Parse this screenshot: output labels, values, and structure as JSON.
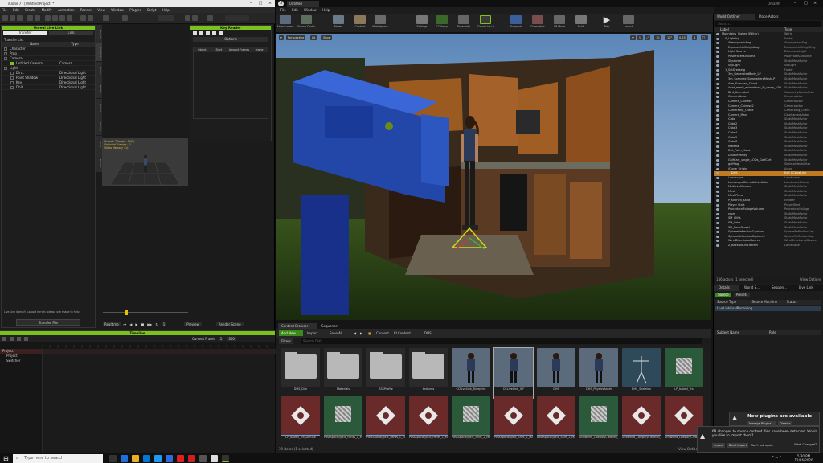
{
  "left_app": {
    "title": "iClone 7 - [Untitled Project] *",
    "menu": [
      "File",
      "Edit",
      "Create",
      "Modify",
      "Animation",
      "Render",
      "View",
      "Window",
      "Plugins",
      "Script",
      "Help"
    ],
    "transfer_title": "Unreal Live Link",
    "tabs": [
      "Transfer",
      "Link"
    ],
    "transfer_list_label": "Transfer List",
    "col_name": "Name",
    "col_type": "Type",
    "transfer_rows": [
      {
        "name": "Character",
        "type": ""
      },
      {
        "name": "Prop",
        "type": ""
      },
      {
        "name": "Camera",
        "type": ""
      },
      {
        "name": "Untitled Camera",
        "type": "Camera"
      },
      {
        "name": "Light",
        "type": ""
      },
      {
        "name": "Dirct",
        "type": "Directional Light"
      },
      {
        "name": "Point Shadow",
        "type": "Directional Light"
      },
      {
        "name": "Key",
        "type": "Directional Light"
      },
      {
        "name": "Dhit",
        "type": "Directional Light"
      }
    ],
    "side_tabs": [
      "Project",
      "Content",
      "Scene",
      "Modify",
      "Visual",
      "Library",
      "Anim",
      "Render"
    ],
    "hint": "Live Link doesn't support terrain, please use shape to help.",
    "transfer_button": "Transfer File",
    "keyreader": {
      "title": "Key Reader",
      "panel": "Options",
      "cols": [
        "Object",
        "Start",
        "Amount Frames",
        "Frame"
      ]
    },
    "viewport_overlay": [
      "Smooth Triangle : 10(2)",
      "Selected Triangle : 0",
      "Video Memory : 1/1"
    ],
    "playback": {
      "realtime": "Realtime",
      "frame": "1",
      "preview": "Preview",
      "render_scene": "Render Scene"
    },
    "timeline": {
      "title": "Timeline",
      "current_frame": "1",
      "end_frame": "300",
      "tracks": [
        "Project",
        "Project",
        "Switcher"
      ]
    }
  },
  "ue": {
    "tab": "Untitled",
    "window_label": "OmaMh",
    "menu": [
      "File",
      "Edit",
      "Window",
      "Help"
    ],
    "toolbar": [
      {
        "label": "Save Current",
        "icon": "save-icon"
      },
      {
        "label": "Source Control",
        "icon": "source-control-icon"
      },
      {
        "label": "Modes",
        "icon": "modes-icon"
      },
      {
        "label": "Content",
        "icon": "content-icon"
      },
      {
        "label": "Marketplace",
        "icon": "marketplace-icon"
      },
      {
        "label": "Settings",
        "icon": "settings-icon"
      },
      {
        "label": "CC Setup",
        "icon": "cc-setup-icon"
      },
      {
        "label": "Datasmith",
        "icon": "datasmith-icon"
      },
      {
        "label": "iClone Live Link",
        "icon": "iclone-live-link-icon"
      },
      {
        "label": "Blueprints",
        "icon": "blueprints-icon"
      },
      {
        "label": "Cinematics",
        "icon": "cinematics-icon"
      },
      {
        "label": "VR Mode",
        "icon": "vr-mode-icon"
      },
      {
        "label": "Build",
        "icon": "build-icon"
      },
      {
        "label": "Play",
        "icon": "play-icon"
      },
      {
        "label": "Launch",
        "icon": "launch-icon"
      }
    ],
    "viewport": {
      "perspective": "Perspective",
      "lit": "Lit",
      "show": "Show",
      "grid": "10",
      "angle": "10°",
      "scale": "0.25",
      "speed": "4"
    },
    "content_browser": {
      "tabs": [
        "Content Browser",
        "Sequencer"
      ],
      "add_new": "Add New",
      "import": "Import",
      "save_all": "Save All",
      "path": [
        "Content",
        "RLContent",
        "DHS"
      ],
      "filters": "Filters",
      "search_placeholder": "Search DHS",
      "status": "39 items (1 selected)",
      "view_options": "View Options",
      "assets_row1": [
        {
          "label": "DHS_Dim",
          "type": "folder"
        },
        {
          "label": "Materials",
          "type": "folder"
        },
        {
          "label": "SSSProfile",
          "type": "folder"
        },
        {
          "label": "textures",
          "type": "folder"
        },
        {
          "label": "CCLiveLink_Blueprint",
          "type": "char"
        },
        {
          "label": "CCLiveLink_ICF",
          "type": "char"
        },
        {
          "label": "DHS",
          "type": "char"
        },
        {
          "label": "DHS_PhysicsAsset",
          "type": "char"
        },
        {
          "label": "DHS_Skeleton",
          "type": "skeleton"
        },
        {
          "label": "LP_baked_Tra",
          "type": "texture"
        }
      ],
      "assets_row2": [
        {
          "label": "LP_baked_Tra_Diffuse",
          "type": "material"
        },
        {
          "label": "PostApocalyptic_Pants_1_MAT_Pbr",
          "type": "texture"
        },
        {
          "label": "PostApocalyptic_Pants_1_MAT_Pbr_Diffuse",
          "type": "material"
        },
        {
          "label": "PostApocalyptic_Pants_1_MAT_Pbr_Normal",
          "type": "material"
        },
        {
          "label": "PostApocalyptic_Shirt_2_MAT_Pbr",
          "type": "texture"
        },
        {
          "label": "PostApocalyptic_Shirt_2_MAT_Pbr_Diffuse",
          "type": "material"
        },
        {
          "label": "PostApocalyptic_Shirt_2_MAT_Pbr_Normal",
          "type": "material"
        },
        {
          "label": "Snowbird_LowpolyCleaned_baked_Tra",
          "type": "texture"
        },
        {
          "label": "Snowbird_LowpolyCleaned_baked_Tra_Diffuse",
          "type": "material"
        },
        {
          "label": "Snowbird_LowpolyCleaned_baked_Tra_Normal",
          "type": "material"
        }
      ]
    },
    "outliner": {
      "tabs": [
        "World Outliner",
        "Place Actors"
      ],
      "search_placeholder": "Search...",
      "col_label": "Label",
      "col_type": "Type",
      "rows": [
        {
          "name": "Mountains_Slaked (Editor)",
          "type": "World",
          "d": 0
        },
        {
          "name": "0_Lighting",
          "type": "Folder",
          "d": 1
        },
        {
          "name": "AtmosphericFog",
          "type": "AtmosphericFog",
          "d": 2
        },
        {
          "name": "ExponentialHeightFog",
          "type": "ExponentialHeightFog",
          "d": 2
        },
        {
          "name": "Light Source",
          "type": "DirectionalLight",
          "d": 2
        },
        {
          "name": "PostProcessVolume",
          "type": "PostProcessVolume",
          "d": 2
        },
        {
          "name": "Skydome",
          "type": "StaticMeshActor",
          "d": 2
        },
        {
          "name": "SkyLight",
          "type": "SkyLight",
          "d": 2
        },
        {
          "name": "1_SetDressing",
          "type": "Folder",
          "d": 1
        },
        {
          "name": "3m_GeneratedBody_LP",
          "type": "StaticMeshActor",
          "d": 2
        },
        {
          "name": "3m_Scanned_SomewhereMeshLP",
          "type": "StaticMeshActor",
          "d": 2
        },
        {
          "name": "Arm_Scanned_Coord",
          "type": "StaticMeshActor",
          "d": 2
        },
        {
          "name": "Aunt_mesh_animations_M_camp_LOD",
          "type": "StaticMeshActor",
          "d": 2
        },
        {
          "name": "Bird_Animated",
          "type": "GeometryCacheActor",
          "d": 2
        },
        {
          "name": "CameraActor",
          "type": "CameraActor",
          "d": 2
        },
        {
          "name": "Camera_Chinese",
          "type": "CameraActor",
          "d": 2
        },
        {
          "name": "Camera_Chinese2",
          "type": "CameraActor",
          "d": 2
        },
        {
          "name": "CameraRig_Crane",
          "type": "CameraRig_Crane",
          "d": 2
        },
        {
          "name": "Camera_Mara",
          "type": "CineCameraActor",
          "d": 2
        },
        {
          "name": "Cube",
          "type": "StaticMeshActor",
          "d": 2
        },
        {
          "name": "Cube2",
          "type": "StaticMeshActor",
          "d": 2
        },
        {
          "name": "Cube3",
          "type": "StaticMeshActor",
          "d": 2
        },
        {
          "name": "Cube4",
          "type": "StaticMeshActor",
          "d": 2
        },
        {
          "name": "Cube5",
          "type": "StaticMeshActor",
          "d": 2
        },
        {
          "name": "Cube6",
          "type": "StaticMeshActor",
          "d": 2
        },
        {
          "name": "Material",
          "type": "StaticMeshActor",
          "d": 2
        },
        {
          "name": "Dirt_Palm_Hous",
          "type": "StaticMeshActor",
          "d": 2
        },
        {
          "name": "DoubleVanity",
          "type": "StaticMeshActor",
          "d": 2
        },
        {
          "name": "GolfCart_single_LODs_GolfCart",
          "type": "StaticMeshActor",
          "d": 2
        },
        {
          "name": "golfflag",
          "type": "SkeletalMeshActor",
          "d": 2
        },
        {
          "name": "iClone_Origin",
          "type": "Actor",
          "d": 2
        },
        {
          "name": "DHS",
          "type": "Edit CCLiveLink",
          "d": 3,
          "selected": true
        },
        {
          "name": "Landscape",
          "type": "Landscape",
          "d": 2
        },
        {
          "name": "LandscapeGizmoActiveActor",
          "type": "LandscapeGizmo",
          "d": 2
        },
        {
          "name": "MedievalHouses",
          "type": "StaticMeshActor",
          "d": 2
        },
        {
          "name": "Mesh",
          "type": "StaticMeshActor",
          "d": 2
        },
        {
          "name": "MeshPlane",
          "type": "StaticMeshActor",
          "d": 2
        },
        {
          "name": "P_Kitchen_sand",
          "type": "Emitter",
          "d": 2
        },
        {
          "name": "Player Start",
          "type": "PlayerStart",
          "d": 2
        },
        {
          "name": "ProceduralFoliageVolume",
          "type": "ProceduralFoliage",
          "d": 2
        },
        {
          "name": "room",
          "type": "StaticMeshActor",
          "d": 2
        },
        {
          "name": "SM_Cliffs",
          "type": "StaticMeshActor",
          "d": 2
        },
        {
          "name": "SM_Lake",
          "type": "StaticMeshActor",
          "d": 2
        },
        {
          "name": "SM_RockGravel",
          "type": "StaticMeshActor",
          "d": 2
        },
        {
          "name": "SphereReflectionCapture",
          "type": "SphereReflectionCap",
          "d": 2
        },
        {
          "name": "SphereReflectionCapture2",
          "type": "SphereReflectionCap",
          "d": 2
        },
        {
          "name": "WindDirectionalSource",
          "type": "WindDirectionalSource",
          "d": 2
        },
        {
          "name": "Z_BackgroundTerrain",
          "type": "Landscape",
          "d": 2
        }
      ],
      "count": "146 actors (1 selected)",
      "view_options": "View Options"
    },
    "details": {
      "tabs": [
        "Details",
        "World S...",
        "Sequen...",
        "Live Link"
      ],
      "source_btn": "Source",
      "presets": "Presets",
      "cols": [
        "Source Type",
        "Source Machine",
        "Status"
      ],
      "source_row": "LiveLinkEvalReceiving",
      "subject_cols": [
        "Subject Name",
        "Role"
      ]
    },
    "notification": {
      "title": "New plugins are available",
      "manage": "Manage Plugins...",
      "dismiss": "Dismiss",
      "message": "68 changes to source content files have been detected. Would you like to import them?",
      "import": "Import",
      "dont_import": "Don't Import",
      "dont_ask": "Don't ask again",
      "whats_changed": "What Changed?"
    }
  },
  "taskbar": {
    "search_placeholder": "Type here to search",
    "time": "5:30 PM",
    "date": "12/26/2020"
  }
}
